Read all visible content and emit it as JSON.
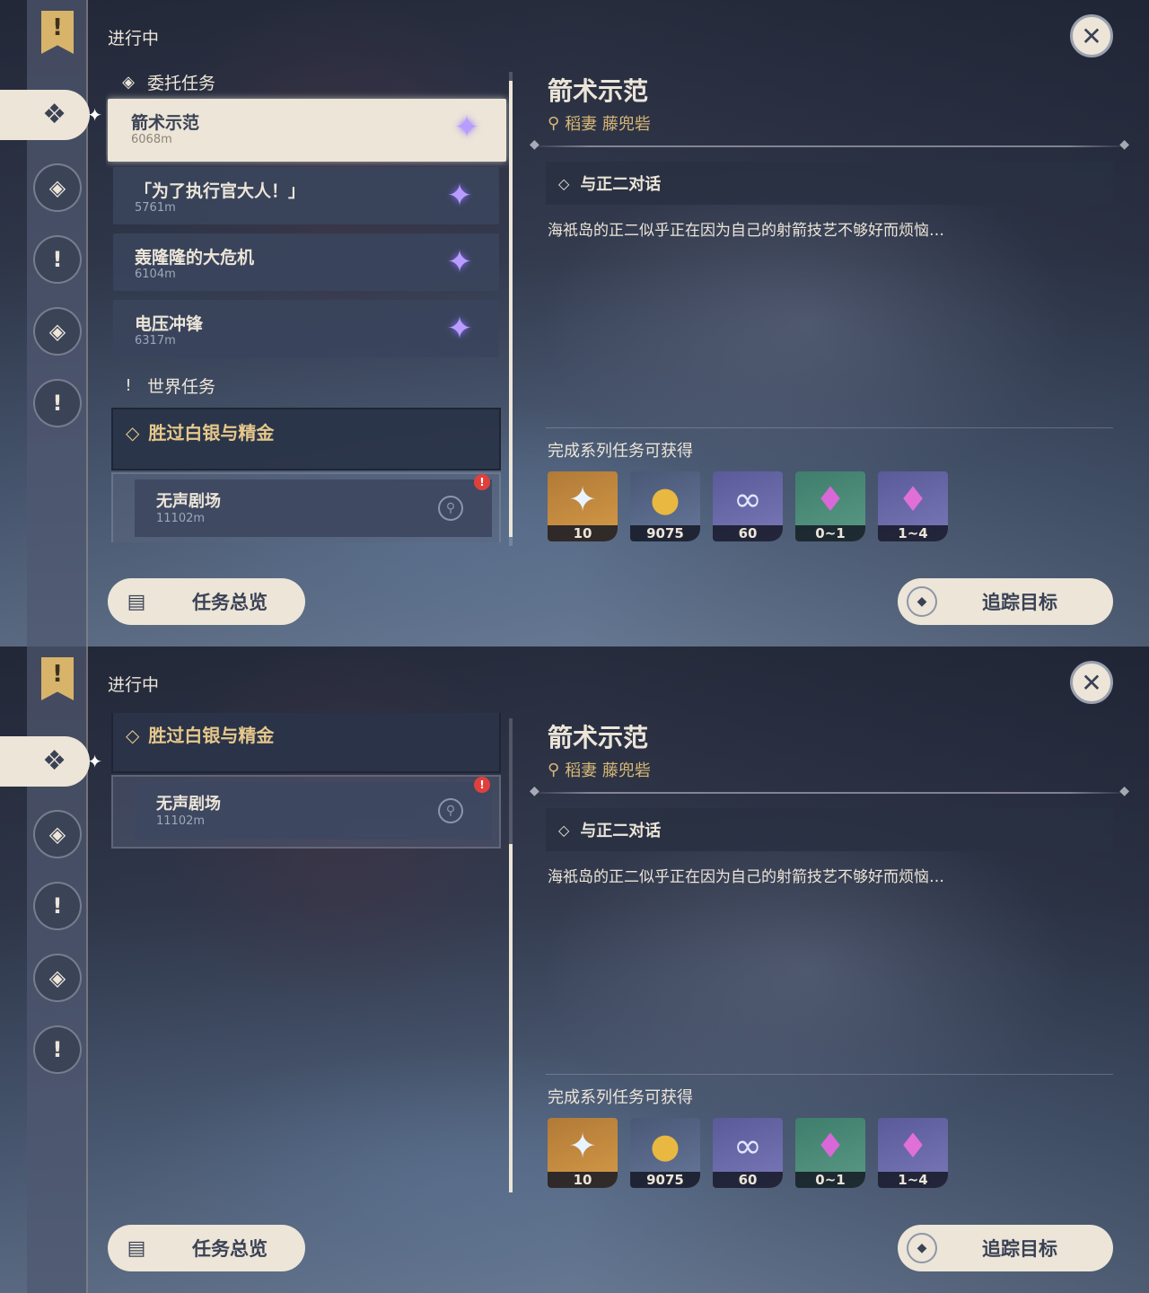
{
  "status_title": "进行中",
  "sidebar": {
    "banner_glyph": "!",
    "active_glyph": "❖",
    "icons": [
      "◈",
      "!",
      "◈",
      "!"
    ]
  },
  "categories": {
    "commission": {
      "label": "委托任务",
      "icon": "◈"
    },
    "world": {
      "label": "世界任务",
      "icon": "!"
    }
  },
  "quests": [
    {
      "name": "箭术示范",
      "distance": "6068m",
      "selected": true
    },
    {
      "name": "「为了执行官大人！」",
      "distance": "5761m",
      "selected": false
    },
    {
      "name": "轰隆隆的大危机",
      "distance": "6104m",
      "selected": false
    },
    {
      "name": "电压冲锋",
      "distance": "6317m",
      "selected": false
    }
  ],
  "world_quest": {
    "name": "胜过白银与精金",
    "sub": {
      "name": "无声剧场",
      "distance": "11102m",
      "alert": "!"
    }
  },
  "detail": {
    "title": "箭术示范",
    "location": "稻妻 藤兜砦",
    "objective": "与正二对话",
    "description": "海祇岛的正二似乎正在因为自己的射箭技艺不够好而烦恼…",
    "rewards_title": "完成系列任务可获得",
    "rewards": [
      {
        "icon": "primogem-icon",
        "glyph": "✦",
        "count": "10",
        "bg": "gold"
      },
      {
        "icon": "mora-icon",
        "glyph": "●",
        "count": "9075",
        "bg": "blue"
      },
      {
        "icon": "fetters-icon",
        "glyph": "∞",
        "count": "60",
        "bg": "purple"
      },
      {
        "icon": "crystal-icon",
        "glyph": "♦",
        "count": "0~1",
        "bg": "green"
      },
      {
        "icon": "crystal-cluster-icon",
        "glyph": "♦",
        "count": "1~4",
        "bg": "purple"
      }
    ]
  },
  "buttons": {
    "overview": "任务总览",
    "track": "追踪目标"
  },
  "colors": {
    "cream": "#ece5d8",
    "gold_text": "#e6c88c",
    "star_purple": "#b99cff",
    "alert_red": "#e0403c"
  }
}
